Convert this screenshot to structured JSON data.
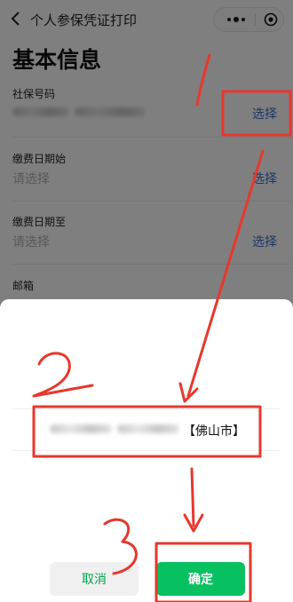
{
  "header": {
    "title": "个人参保凭证打印"
  },
  "page": {
    "heading": "基本信息"
  },
  "fields": [
    {
      "label": "社保号码",
      "value": "",
      "action": "选择"
    },
    {
      "label": "缴费日期始",
      "value": "请选择",
      "action": "选择"
    },
    {
      "label": "缴费日期至",
      "value": "请选择",
      "action": "选择"
    },
    {
      "label": "邮箱",
      "value": "",
      "action": ""
    }
  ],
  "sheet": {
    "option_suffix": "【佛山市】",
    "cancel_label": "取消",
    "confirm_label": "确定"
  },
  "annotations": {
    "step1": "1",
    "step2": "2",
    "step3": "3"
  },
  "colors": {
    "link": "#3b6fd1",
    "primary": "#07c160",
    "annotation": "#e8372c"
  }
}
